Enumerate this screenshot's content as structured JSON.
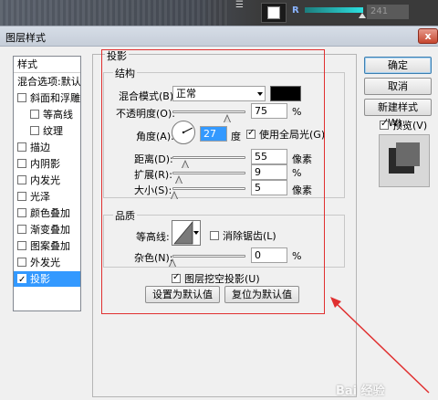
{
  "photoshop_bar": {
    "channel_label": "R",
    "channel_value": "241"
  },
  "dialog": {
    "title": "图层样式",
    "close_label": "x"
  },
  "styles": {
    "header": "样式",
    "items": [
      {
        "label": "混合选项:默认",
        "checkbox": false,
        "checked": false,
        "sub": false,
        "selected": false
      },
      {
        "label": "斜面和浮雕",
        "checkbox": true,
        "checked": false,
        "sub": false,
        "selected": false
      },
      {
        "label": "等高线",
        "checkbox": true,
        "checked": false,
        "sub": true,
        "selected": false
      },
      {
        "label": "纹理",
        "checkbox": true,
        "checked": false,
        "sub": true,
        "selected": false
      },
      {
        "label": "描边",
        "checkbox": true,
        "checked": false,
        "sub": false,
        "selected": false
      },
      {
        "label": "内阴影",
        "checkbox": true,
        "checked": false,
        "sub": false,
        "selected": false
      },
      {
        "label": "内发光",
        "checkbox": true,
        "checked": false,
        "sub": false,
        "selected": false
      },
      {
        "label": "光泽",
        "checkbox": true,
        "checked": false,
        "sub": false,
        "selected": false
      },
      {
        "label": "颜色叠加",
        "checkbox": true,
        "checked": false,
        "sub": false,
        "selected": false
      },
      {
        "label": "渐变叠加",
        "checkbox": true,
        "checked": false,
        "sub": false,
        "selected": false
      },
      {
        "label": "图案叠加",
        "checkbox": true,
        "checked": false,
        "sub": false,
        "selected": false
      },
      {
        "label": "外发光",
        "checkbox": true,
        "checked": false,
        "sub": false,
        "selected": false
      },
      {
        "label": "投影",
        "checkbox": true,
        "checked": true,
        "sub": false,
        "selected": true
      }
    ]
  },
  "buttons": {
    "ok": "确定",
    "cancel": "取消",
    "new_style": "新建样式(W)...",
    "preview_label": "预览(V)",
    "preview_checked": true
  },
  "drop_shadow": {
    "section_title": "投影",
    "structure_title": "结构",
    "blend_mode_label": "混合模式(B):",
    "blend_mode_value": "正常",
    "shadow_color": "#000000",
    "opacity_label": "不透明度(O):",
    "opacity_value": "75",
    "opacity_unit": "%",
    "opacity_fraction": 0.75,
    "angle_label": "角度(A):",
    "angle_value": "27",
    "angle_unit": "度",
    "global_light_label": "使用全局光(G)",
    "global_light_checked": true,
    "distance_label": "距离(D):",
    "distance_value": "55",
    "distance_unit": "像素",
    "distance_fraction": 0.18,
    "spread_label": "扩展(R):",
    "spread_value": "9",
    "spread_unit": "%",
    "spread_fraction": 0.09,
    "size_label": "大小(S):",
    "size_value": "5",
    "size_unit": "像素",
    "size_fraction": 0.02,
    "quality_title": "品质",
    "contour_label": "等高线:",
    "antialias_label": "消除锯齿(L)",
    "antialias_checked": false,
    "noise_label": "杂色(N):",
    "noise_value": "0",
    "noise_unit": "%",
    "noise_fraction": 0,
    "knockout_label": "图层挖空投影(U)",
    "knockout_checked": true,
    "set_default": "设置为默认值",
    "reset_default": "复位为默认值"
  },
  "annotation_color": "#e03030",
  "watermark": "Bai 经验"
}
